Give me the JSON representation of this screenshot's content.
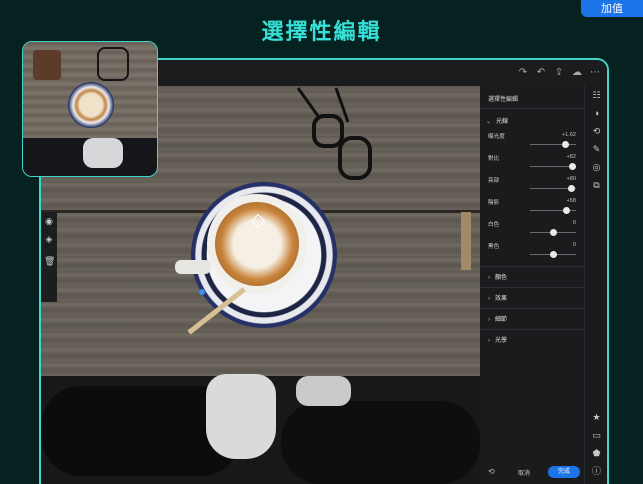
{
  "banner": {
    "title": "選擇性編輯",
    "badge": "加值"
  },
  "toolbar": {
    "icons": [
      "redo-icon",
      "undo-icon",
      "share-icon",
      "cloud-sync-icon",
      "more-icon"
    ]
  },
  "panel": {
    "title": "選擇性編輯",
    "section_light": "光線",
    "sliders": [
      {
        "label": "曝光度",
        "value": "+1.62",
        "level": 0.77
      },
      {
        "label": "對比",
        "value": "+82",
        "level": 0.91
      },
      {
        "label": "亮部",
        "value": "+80",
        "level": 0.9
      },
      {
        "label": "陰影",
        "value": "+58",
        "level": 0.79
      },
      {
        "label": "白色",
        "value": "0",
        "level": 0.5
      },
      {
        "label": "黑色",
        "value": "0",
        "level": 0.5
      }
    ],
    "collapsed_sections": [
      "顏色",
      "效果",
      "細節",
      "光學"
    ],
    "cancel_label": "取消",
    "done_label": "完成"
  },
  "colors": {
    "accent": "#3fd5c8",
    "primary_button": "#1b74e8",
    "background": "#052221"
  }
}
